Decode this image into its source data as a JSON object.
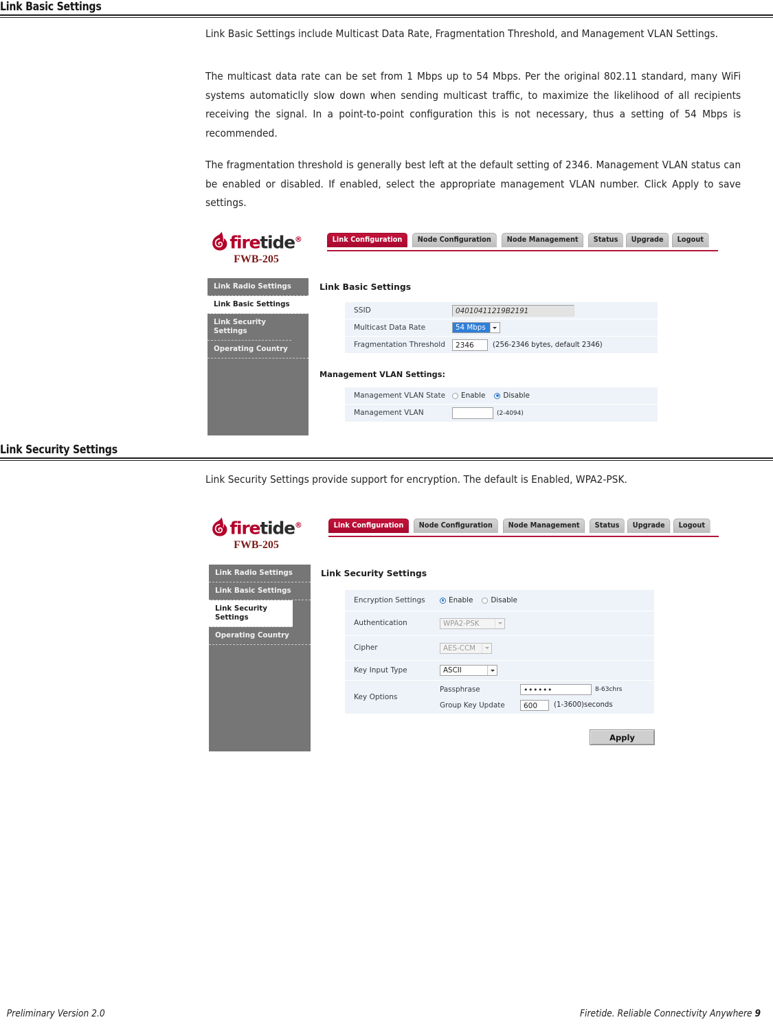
{
  "sections": [
    {
      "heading": "Link Basic Settings",
      "paragraphs": [
        "Link Basic Settings include Multicast Data Rate, Fragmentation Threshold, and Management VLAN Settings.",
        "The multicast data rate can be set from 1 Mbps up to 54 Mbps. Per the original 802.11 standard, many WiFi systems automaticlly slow down when sending multicast traffic, to maximize the likelihood of all recipients receiving the signal. In a point-to-point configuration this is not necessary, thus a setting of 54 Mbps is recommended.",
        "The fragmentation threshold is generally best left at the default setting of 2346. Management VLAN status can be enabled or disabled. If enabled, select the appropriate management VLAN number. Click Apply to save settings."
      ]
    },
    {
      "heading": "Link Security Settings",
      "paragraphs": [
        "Link Security Settings provide support for encryption. The default is Enabled, WPA2-PSK."
      ]
    }
  ],
  "app": {
    "brand": {
      "word_fire": "fire",
      "word_tide": "tide",
      "registered": "®",
      "model": "FWB-205",
      "logo_color": "#b3002a"
    },
    "nav_tabs": [
      {
        "label": "Link Configuration",
        "active": true
      },
      {
        "label": "Node Configuration",
        "active": false
      },
      {
        "label": "Node Management",
        "active": false
      },
      {
        "label": "Status",
        "active": false
      },
      {
        "label": "Upgrade",
        "active": false
      },
      {
        "label": "Logout",
        "active": false
      }
    ],
    "accent_color": "#b1143a",
    "sidebar_bg": "#767676"
  },
  "shot_basic": {
    "sidebar": [
      {
        "label": "Link Radio Settings",
        "active": false
      },
      {
        "label": "Link Basic Settings",
        "active": true
      },
      {
        "label": "Link Security Settings",
        "active": false
      },
      {
        "label": "Operating Country",
        "active": false
      }
    ],
    "panel_title": "Link Basic Settings",
    "fields": {
      "ssid_label": "SSID",
      "ssid_value": "04010411219B2191",
      "multicast_label": "Multicast Data Rate",
      "multicast_value": "54 Mbps",
      "frag_label": "Fragmentation Threshold",
      "frag_value": "2346",
      "frag_hint": "(256-2346 bytes, default 2346)"
    },
    "vlan_subtitle": "Management VLAN Settings:",
    "vlan": {
      "state_label": "Management VLAN State",
      "state_enable": "Enable",
      "state_disable": "Disable",
      "state_selected": "Disable",
      "vlan_label": "Management VLAN",
      "vlan_value": "",
      "vlan_hint": "(2-4094)"
    }
  },
  "shot_security": {
    "sidebar": [
      {
        "label": "Link Radio Settings",
        "active": false
      },
      {
        "label": "Link Basic Settings",
        "active": false
      },
      {
        "label": "Link Security Settings",
        "active": true
      },
      {
        "label": "Operating Country",
        "active": false
      }
    ],
    "panel_title": "Link Security Settings",
    "fields": {
      "encryption_label": "Encryption Settings",
      "encryption_enable": "Enable",
      "encryption_disable": "Disable",
      "encryption_selected": "Enable",
      "auth_label": "Authentication",
      "auth_value": "WPA2-PSK",
      "cipher_label": "Cipher",
      "cipher_value": "AES-CCM",
      "keytype_label": "Key Input Type",
      "keytype_value": "ASCII",
      "keyopts_label": "Key Options",
      "passphrase_label": "Passphrase",
      "passphrase_value": "••••••",
      "passphrase_hint": "8-63chrs",
      "groupkey_label": "Group Key Update",
      "groupkey_value": "600",
      "groupkey_hint": "(1-3600)seconds"
    },
    "apply_label": "Apply"
  },
  "footer": {
    "left": "Preliminary Version 2.0",
    "right": "Firetide. Reliable Connectivity Anywhere",
    "page": "9"
  }
}
